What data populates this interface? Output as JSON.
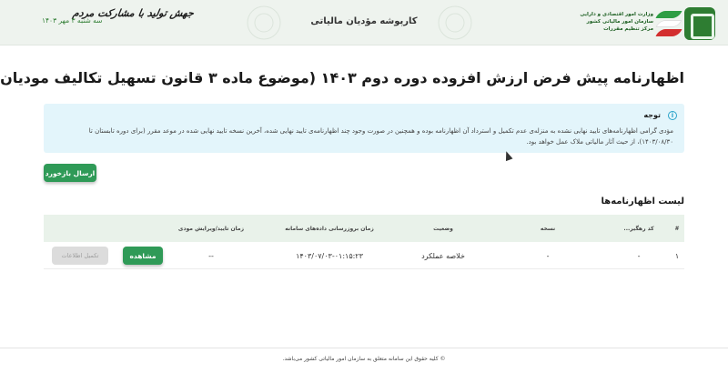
{
  "header": {
    "logo_lines": [
      "وزارت امور اقتصادی و دارایی",
      "سازمان امور مالیاتی کشور",
      "مرکز تنظیم مقررات"
    ],
    "title": "کارپوشه مؤدیان مالیاتی",
    "date": "سه شنبه ۳ مهر ۱۴۰۳",
    "slogan": "جهش تولید با مشارکت مردم"
  },
  "page": {
    "title": "اظهارنامه پیش فرض ارزش افزوده دوره دوم ۱۴۰۳ (موضوع ماده ۳ قانون تسهیل تکالیف مودیان)"
  },
  "notice": {
    "icon": "info-icon",
    "title": "توجه",
    "body": "مؤدی گرامی اظهارنامه‌های تایید نهایی نشده به منزله‌ی عدم تکمیل و استرداد آن اظهارنامه بوده و همچنین در صورت وجود چند اظهارنامه‌ی تایید نهایی شده، آخرین نسخه تایید نهایی شده در موعد مقرر (برای دوره تابستان تا ۱۴۰۳/۰۸/۳۰)، از حیث آثار مالیاتی ملاک عمل خواهد بود."
  },
  "actions": {
    "send_feedback": "ارسال بازخورد"
  },
  "list": {
    "title": "لیست اظهارنامه‌ها",
    "columns": {
      "index": "#",
      "tracking_code": "کد رهگیر...",
      "version": "نسخه",
      "status": "وضعیت",
      "updated": "زمان بروزرسانی داده‌های سامانه",
      "approved": "زمان تایید/ویرایش مودی"
    },
    "rows": [
      {
        "index": "۱",
        "tracking_code": "-",
        "version": "-",
        "status": "خلاصه عملکرد",
        "updated": "۱۴۰۳/۰۷/۰۳-۰۱:۱۵:۲۳",
        "approved": "--",
        "view_label": "مشاهده",
        "complete_label": "تکمیل اطلاعات"
      }
    ]
  },
  "footer": {
    "text": "© کلیه حقوق این سامانه متعلق به سازمان امور مالیاتی کشور می‌باشد."
  },
  "colors": {
    "primary_green": "#2f9a57",
    "header_bg": "#eef3ee",
    "notice_bg": "#e3f5fb",
    "table_header_bg": "#e9f2ea"
  }
}
